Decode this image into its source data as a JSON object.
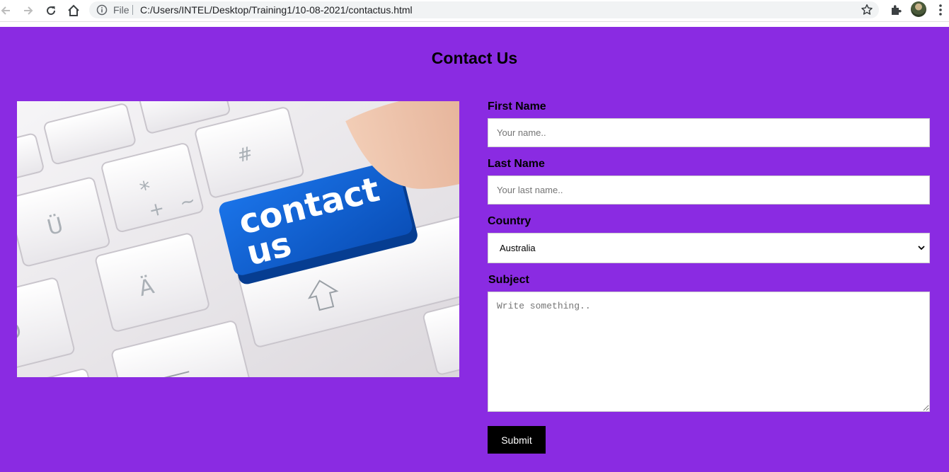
{
  "browser": {
    "scheme_label": "File",
    "url": "C:/Users/INTEL/Desktop/Training1/10-08-2021/contactus.html",
    "icons": [
      "back-arrow-icon",
      "forward-arrow-icon",
      "reload-icon",
      "home-icon",
      "info-icon",
      "star-icon",
      "extensions-puzzle-icon",
      "profile-avatar",
      "kebab-menu-icon"
    ]
  },
  "page": {
    "background": "#8a2be2",
    "title": "Contact Us"
  },
  "hero_image": {
    "key_text": "contact us",
    "key_color": "#0a5fd6"
  },
  "form": {
    "first_name_label": "First Name",
    "first_name_placeholder": "Your name..",
    "last_name_label": "Last Name",
    "last_name_placeholder": "Your last name..",
    "country_label": "Country",
    "country_value": "Australia",
    "subject_label": "Subject",
    "subject_placeholder": "Write something..",
    "submit_label": "Submit"
  }
}
